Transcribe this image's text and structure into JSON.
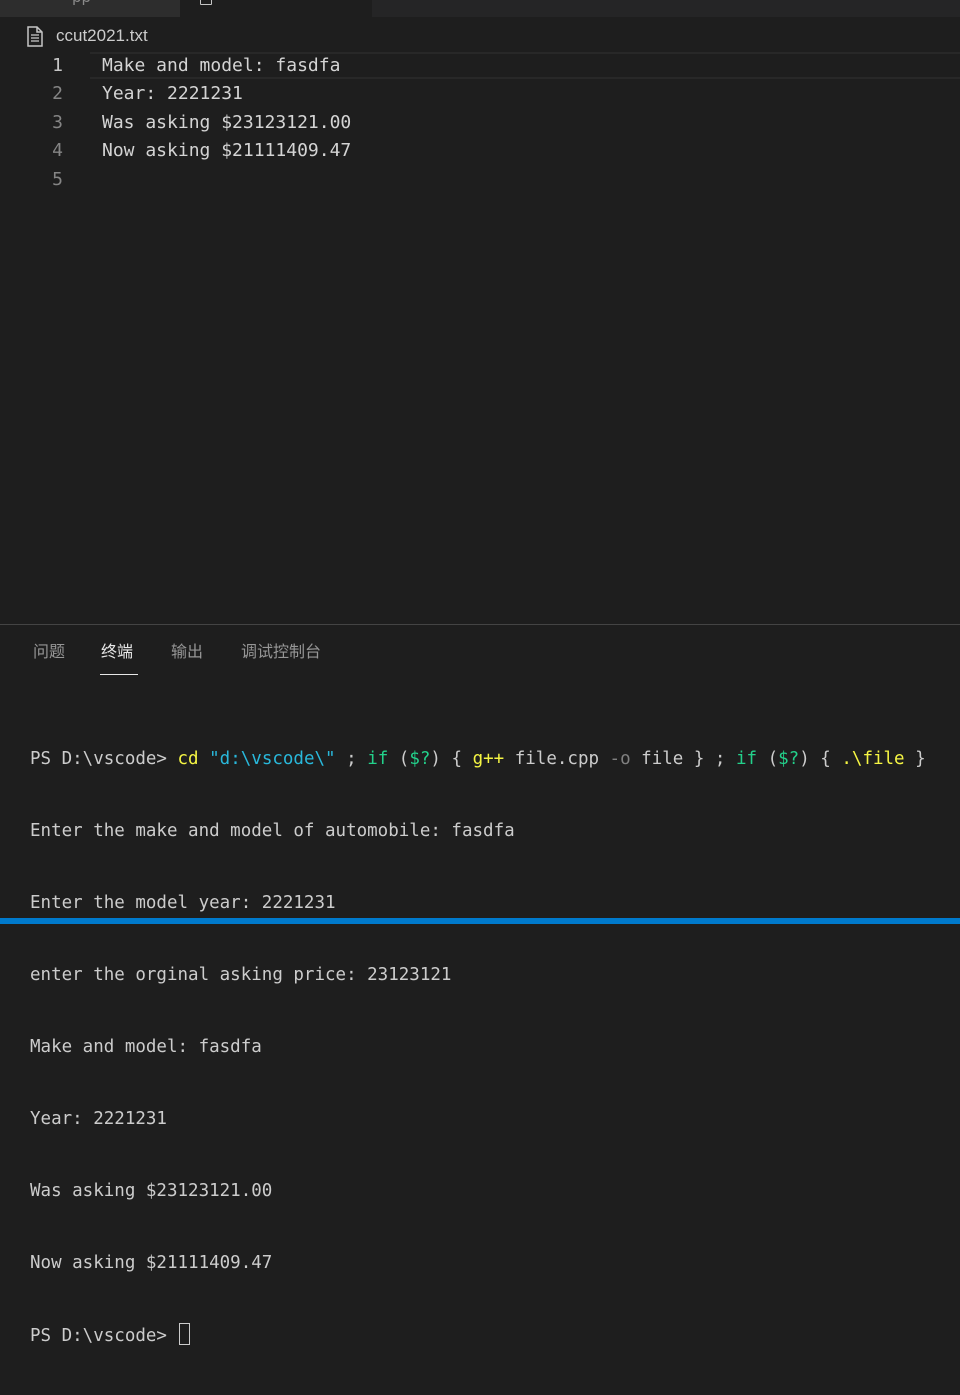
{
  "tabs": {
    "tab1_fragment": "pp"
  },
  "breadcrumb": {
    "icon": "file-text-icon",
    "filename": "ccut2021.txt"
  },
  "editor": {
    "active_line": 1,
    "lines": [
      {
        "number": "1",
        "text": "Make and model: fasdfa"
      },
      {
        "number": "2",
        "text": "Year: 2221231"
      },
      {
        "number": "3",
        "text": "Was asking $23123121.00"
      },
      {
        "number": "4",
        "text": "Now asking $21111409.47"
      },
      {
        "number": "5",
        "text": ""
      }
    ]
  },
  "panel": {
    "tabs": [
      {
        "label": "问题"
      },
      {
        "label": "终端"
      },
      {
        "label": "输出"
      },
      {
        "label": "调试控制台"
      }
    ],
    "active_tab": "终端"
  },
  "terminal": {
    "command": {
      "prompt": "PS D:\\vscode> ",
      "cd": "cd",
      "path": "\"d:\\vscode\\\"",
      "sep1": " ; ",
      "if1": "if",
      "sp1": " (",
      "var1": "$?",
      "close1": ") { ",
      "gpp": "g++",
      "args1": " file.cpp ",
      "flag": "-o",
      "args2": " file } ; ",
      "if2": "if",
      "sp2": " (",
      "var2": "$?",
      "close2": ") { ",
      "run": ".\\file",
      "end": " }"
    },
    "output": [
      "Enter the make and model of automobile: fasdfa",
      "Enter the model year: 2221231",
      "enter the orginal asking price: 23123121",
      "Make and model: fasdfa",
      "Year: 2221231",
      "Was asking $23123121.00",
      "Now asking $21111409.47"
    ],
    "final_prompt": "PS D:\\vscode> "
  },
  "colors": {
    "background": "#1e1e1e",
    "terminal_yellow": "#f5f543",
    "terminal_cyan": "#29b8db",
    "terminal_green": "#23d18b",
    "statusbar": "#007acc"
  }
}
